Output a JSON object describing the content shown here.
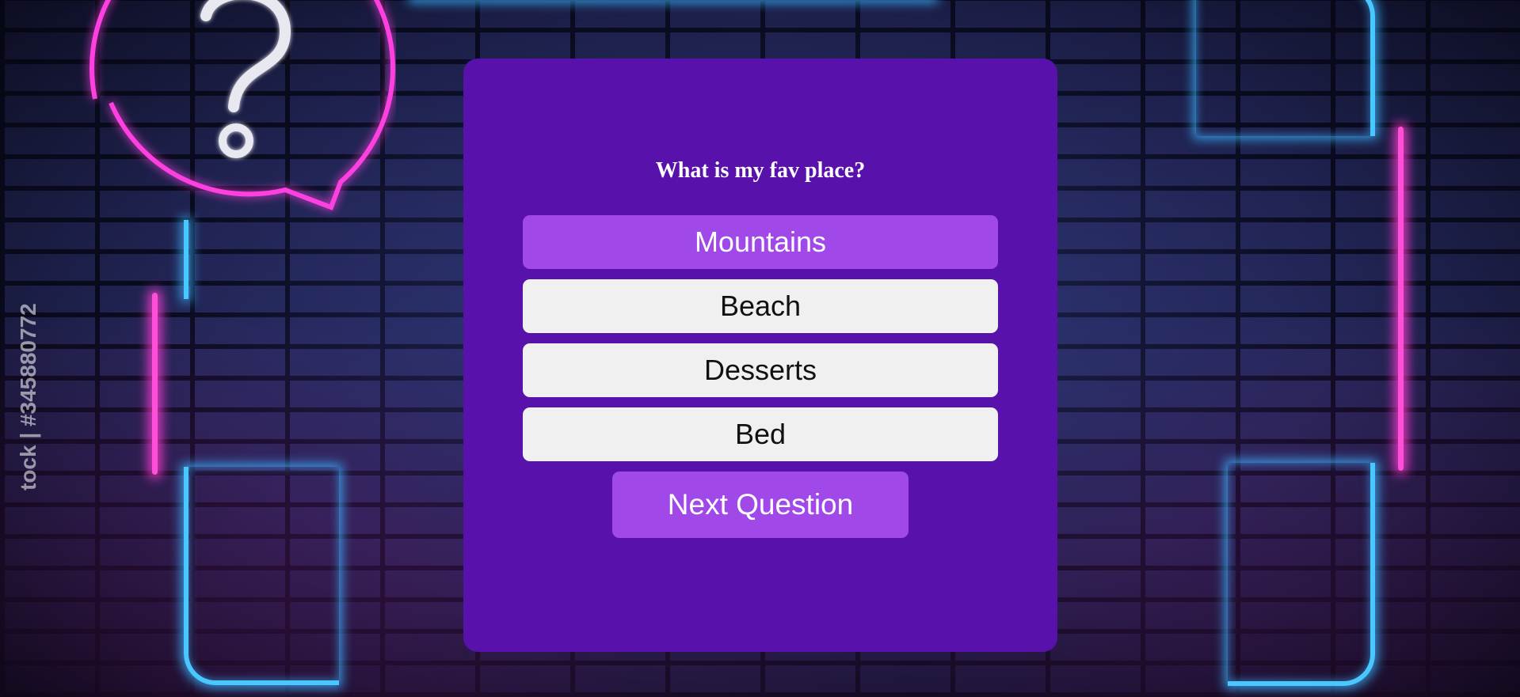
{
  "question": {
    "text": "What is my fav place?"
  },
  "answers": [
    {
      "label": "Mountains",
      "selected": true
    },
    {
      "label": "Beach",
      "selected": false
    },
    {
      "label": "Desserts",
      "selected": false
    },
    {
      "label": "Bed",
      "selected": false
    }
  ],
  "next_button": {
    "label": "Next Question"
  },
  "background": {
    "watermark": "tock | #345880772"
  },
  "colors": {
    "card": "#5811ab",
    "accent": "#a048e8",
    "answer_default": "#f0f0f0",
    "neon_blue": "#48c8ff",
    "neon_pink": "#ff4fd8"
  }
}
